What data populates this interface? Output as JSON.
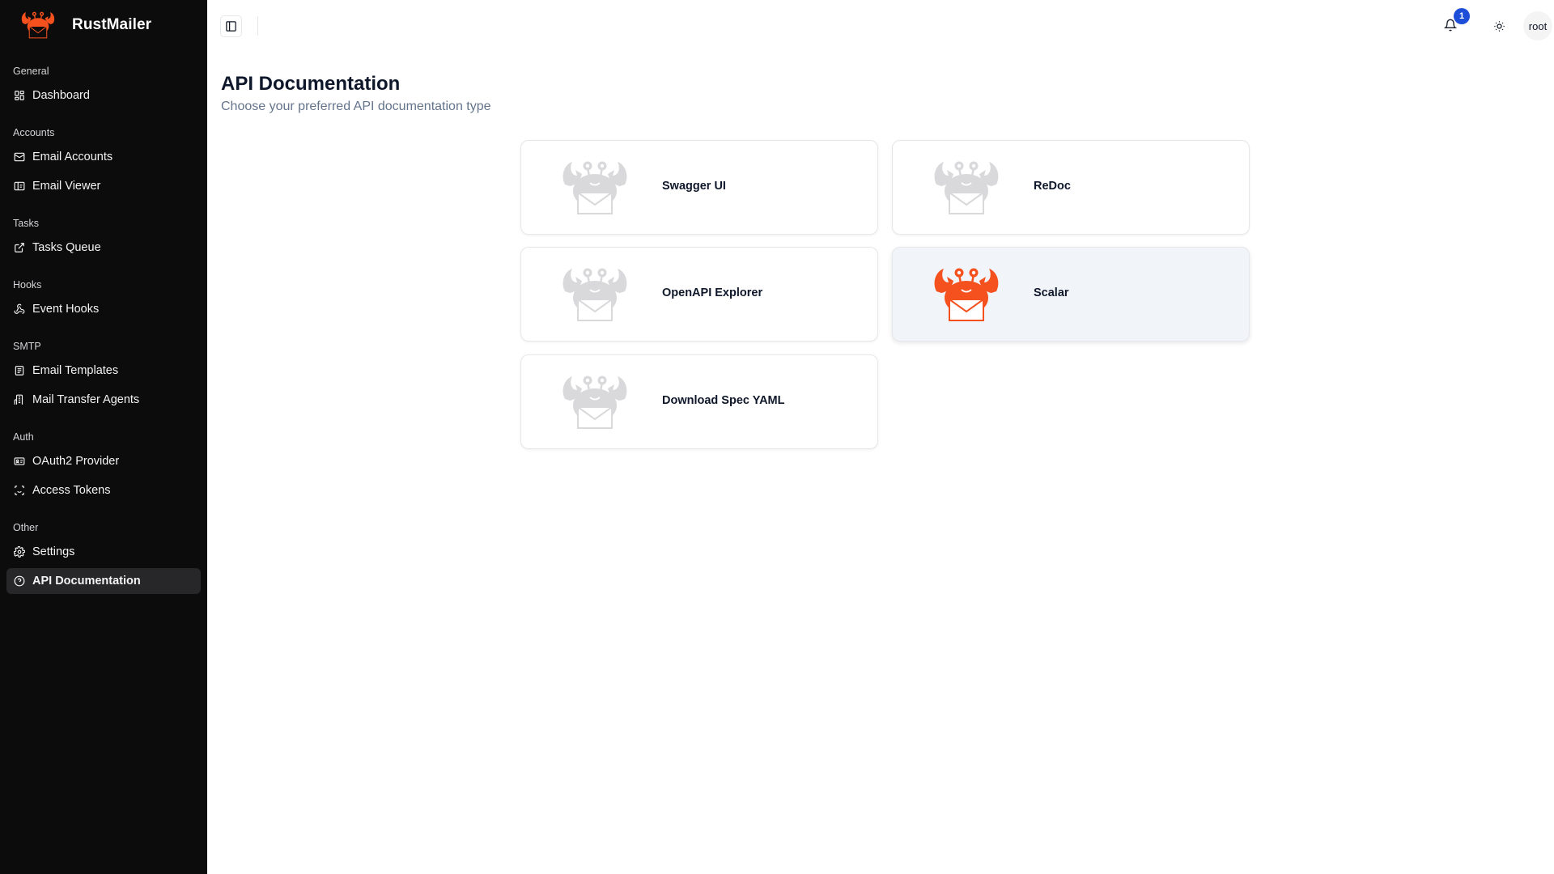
{
  "app": {
    "name": "RustMailer"
  },
  "sidebar": {
    "groups": [
      {
        "label": "General",
        "items": [
          {
            "label": "Dashboard",
            "icon": "dashboard-icon"
          }
        ]
      },
      {
        "label": "Accounts",
        "items": [
          {
            "label": "Email Accounts",
            "icon": "mail-icon"
          },
          {
            "label": "Email Viewer",
            "icon": "viewer-icon"
          }
        ]
      },
      {
        "label": "Tasks",
        "items": [
          {
            "label": "Tasks Queue",
            "icon": "external-link-icon"
          }
        ]
      },
      {
        "label": "Hooks",
        "items": [
          {
            "label": "Event Hooks",
            "icon": "webhook-icon"
          }
        ]
      },
      {
        "label": "SMTP",
        "items": [
          {
            "label": "Email Templates",
            "icon": "template-icon"
          },
          {
            "label": "Mail Transfer Agents",
            "icon": "building-icon"
          }
        ]
      },
      {
        "label": "Auth",
        "items": [
          {
            "label": "OAuth2 Provider",
            "icon": "id-card-icon"
          },
          {
            "label": "Access Tokens",
            "icon": "scan-face-icon"
          }
        ]
      },
      {
        "label": "Other",
        "items": [
          {
            "label": "Settings",
            "icon": "gear-icon"
          },
          {
            "label": "API Documentation",
            "icon": "help-circle-icon",
            "active": true
          }
        ]
      }
    ]
  },
  "header": {
    "notification_count": "1",
    "user": "root"
  },
  "main": {
    "title": "API Documentation",
    "subtitle": "Choose your preferred API documentation type",
    "options": [
      {
        "label": "Swagger UI",
        "selected": false
      },
      {
        "label": "ReDoc",
        "selected": false
      },
      {
        "label": "OpenAPI Explorer",
        "selected": false
      },
      {
        "label": "Scalar",
        "selected": true
      },
      {
        "label": "Download Spec YAML",
        "selected": false
      }
    ]
  },
  "colors": {
    "brand_orange": "#f4511e",
    "logo_inactive": "#d9d9dc",
    "sidebar_bg": "#0c0c0c",
    "badge_blue": "#1d4ed8"
  }
}
